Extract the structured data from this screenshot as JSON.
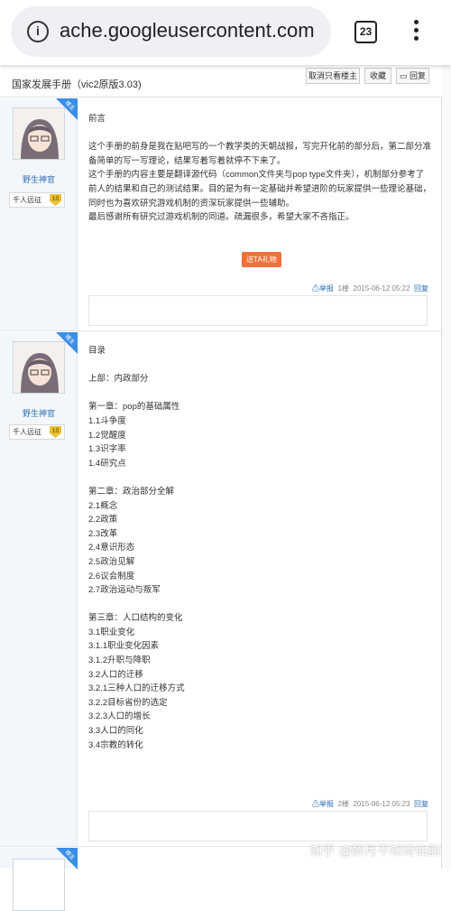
{
  "browser": {
    "url": "ache.googleusercontent.com",
    "tab_count": "23"
  },
  "header": {
    "title": "国家发展手册（vic2原版3.03)",
    "only_op_label": "取消只看楼主",
    "favorite_label": "收藏",
    "reply_label": "回复"
  },
  "posts": [
    {
      "badge": "楼主",
      "username": "野生神官",
      "rank": "千人远征",
      "level": "10",
      "lines": [
        "前言",
        "",
        "这个手册的前身是我在贴吧写的一个教学类的天朝战报，写完开化前的部分后，第二部分准",
        "备简单的写一写理论，结果写着写着就停不下来了。",
        "这个手册的内容主要是翻译源代码（common文件夹与pop type文件夹），机制部分参考了",
        "前人的结果和自己的测试结果。目的是为有一定基础并希望进阶的玩家提供一些理论基础，",
        "同时也为喜欢研究游戏机制的资深玩家提供一些辅助。",
        "最后感谢所有研究过游戏机制的同道。疏漏很多，希望大家不吝指正。"
      ],
      "gift": "送TA礼物",
      "report": "举报",
      "floor": "1楼",
      "time": "2015-06-12 05:22",
      "reply": "回复"
    },
    {
      "badge": "楼主",
      "username": "野生神官",
      "rank": "千人远征",
      "level": "10",
      "lines": [
        "目录",
        "",
        "上部：内政部分",
        "",
        "第一章：pop的基础属性",
        "1.1斗争度",
        "1.2觉醒度",
        "1.3识字率",
        "1.4研究点",
        "",
        "第二章：政治部分全解",
        "2.1概念",
        "2.2政策",
        "2.3改革",
        "2.4意识形态",
        "2.5政治见解",
        "2.6议会制度",
        "2.7政治运动与叛军",
        "",
        "第三章：人口结构的变化",
        "3.1职业变化",
        "3.1.1职业变化因素",
        "3.1.2升职与降职",
        "3.2人口的迁移",
        "3.2.1三种人口的迁移方式",
        "3.2.2目标省份的选定",
        "3.2.3人口的增长",
        "3.3人口的同化",
        "3.4宗教的转化"
      ],
      "report": "举报",
      "floor": "2楼",
      "time": "2015-06-12 05:23",
      "reply": "回复"
    },
    {
      "badge": "楼主"
    }
  ],
  "watermark": "知乎 @醉月不知诗仙韵"
}
